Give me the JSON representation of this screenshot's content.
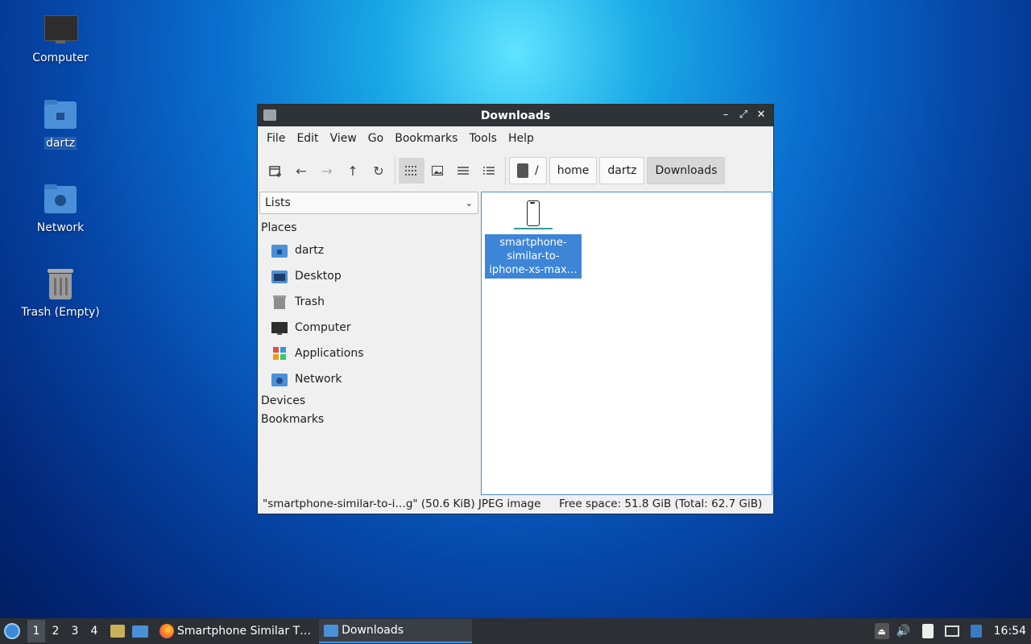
{
  "desktop": {
    "icons": [
      {
        "label": "Computer"
      },
      {
        "label": "dartz"
      },
      {
        "label": "Network"
      },
      {
        "label": "Trash (Empty)"
      }
    ]
  },
  "window": {
    "title": "Downloads",
    "menu": [
      "File",
      "Edit",
      "View",
      "Go",
      "Bookmarks",
      "Tools",
      "Help"
    ],
    "breadcrumb": [
      "/",
      "home",
      "dartz",
      "Downloads"
    ],
    "sidebar": {
      "combo_value": "Lists",
      "places_header": "Places",
      "places": [
        "dartz",
        "Desktop",
        "Trash",
        "Computer",
        "Applications",
        "Network"
      ],
      "devices_header": "Devices",
      "bookmarks_header": "Bookmarks"
    },
    "file": {
      "name": "smartphone-similar-to-iphone-xs-max…",
      "line1": "smartphone-",
      "line2": "similar-to-",
      "line3": "iphone-xs-max…"
    },
    "status": {
      "selection": "\"smartphone-similar-to-i…g\" (50.6 KiB) JPEG image",
      "free_space": "Free space: 51.8 GiB (Total: 62.7 GiB)"
    }
  },
  "taskbar": {
    "workspaces": [
      "1",
      "2",
      "3",
      "4"
    ],
    "tasks": [
      {
        "label": "Smartphone Similar T…"
      },
      {
        "label": "Downloads"
      }
    ],
    "clock": "16:54"
  }
}
